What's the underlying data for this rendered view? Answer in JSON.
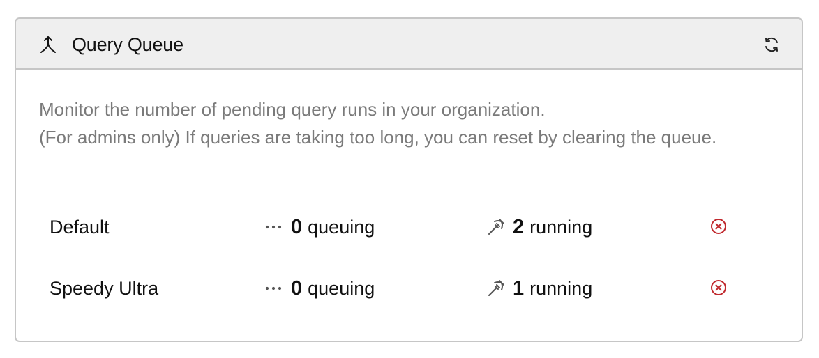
{
  "header": {
    "title": "Query Queue",
    "icon": "merge-icon",
    "refresh_icon": "refresh-icon"
  },
  "description": {
    "line1": "Monitor the number of pending query runs in your organization.",
    "line2": "(For admins only) If queries are taking too long, you can reset by clearing the queue."
  },
  "queues": [
    {
      "name": "Default",
      "queuing_count": "0",
      "queuing_label": "queuing",
      "running_count": "2",
      "running_label": "running"
    },
    {
      "name": "Speedy Ultra",
      "queuing_count": "0",
      "queuing_label": "queuing",
      "running_count": "1",
      "running_label": "running"
    }
  ],
  "colors": {
    "header_bg": "#efefef",
    "border": "#c6c6c6",
    "muted_text": "#7a7a7a",
    "danger": "#c0282d"
  }
}
